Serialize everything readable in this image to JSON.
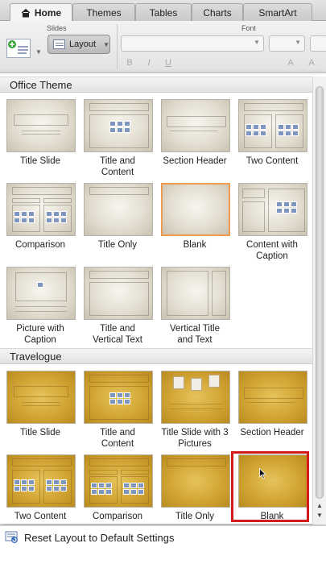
{
  "ribbon": {
    "tabs": [
      {
        "label": "Home",
        "active": true
      },
      {
        "label": "Themes"
      },
      {
        "label": "Tables"
      },
      {
        "label": "Charts"
      },
      {
        "label": "SmartArt"
      }
    ],
    "groups": {
      "slides": "Slides",
      "font": "Font"
    },
    "layout_button": "Layout"
  },
  "gallery": {
    "sections": [
      {
        "title": "Office Theme",
        "items": [
          {
            "name": "Title Slide",
            "label": "Title Slide"
          },
          {
            "name": "Title and Content",
            "label": "Title and\nContent"
          },
          {
            "name": "Section Header",
            "label": "Section Header"
          },
          {
            "name": "Two Content",
            "label": "Two Content"
          },
          {
            "name": "Comparison",
            "label": "Comparison"
          },
          {
            "name": "Title Only",
            "label": "Title Only"
          },
          {
            "name": "Blank",
            "label": "Blank"
          },
          {
            "name": "Content with Caption",
            "label": "Content with\nCaption"
          },
          {
            "name": "Picture with Caption",
            "label": "Picture with\nCaption"
          },
          {
            "name": "Title and Vertical Text",
            "label": "Title and\nVertical Text"
          },
          {
            "name": "Vertical Title and Text",
            "label": "Vertical Title\nand Text"
          }
        ]
      },
      {
        "title": "Travelogue",
        "items": [
          {
            "name": "Title Slide",
            "label": "Title Slide"
          },
          {
            "name": "Title and Content",
            "label": "Title and\nContent"
          },
          {
            "name": "Title Slide with 3 Pictures",
            "label": "Title Slide with 3\nPictures"
          },
          {
            "name": "Section Header",
            "label": "Section Header"
          },
          {
            "name": "Two Content",
            "label": "Two Content"
          },
          {
            "name": "Comparison",
            "label": "Comparison"
          },
          {
            "name": "Title Only",
            "label": "Title Only"
          },
          {
            "name": "Blank",
            "label": "Blank"
          }
        ]
      }
    ]
  },
  "footer": {
    "reset_label": "Reset Layout to Default Settings"
  },
  "colors": {
    "highlight_red": "#d41b1b",
    "selected_orange": "#f09a4d"
  }
}
